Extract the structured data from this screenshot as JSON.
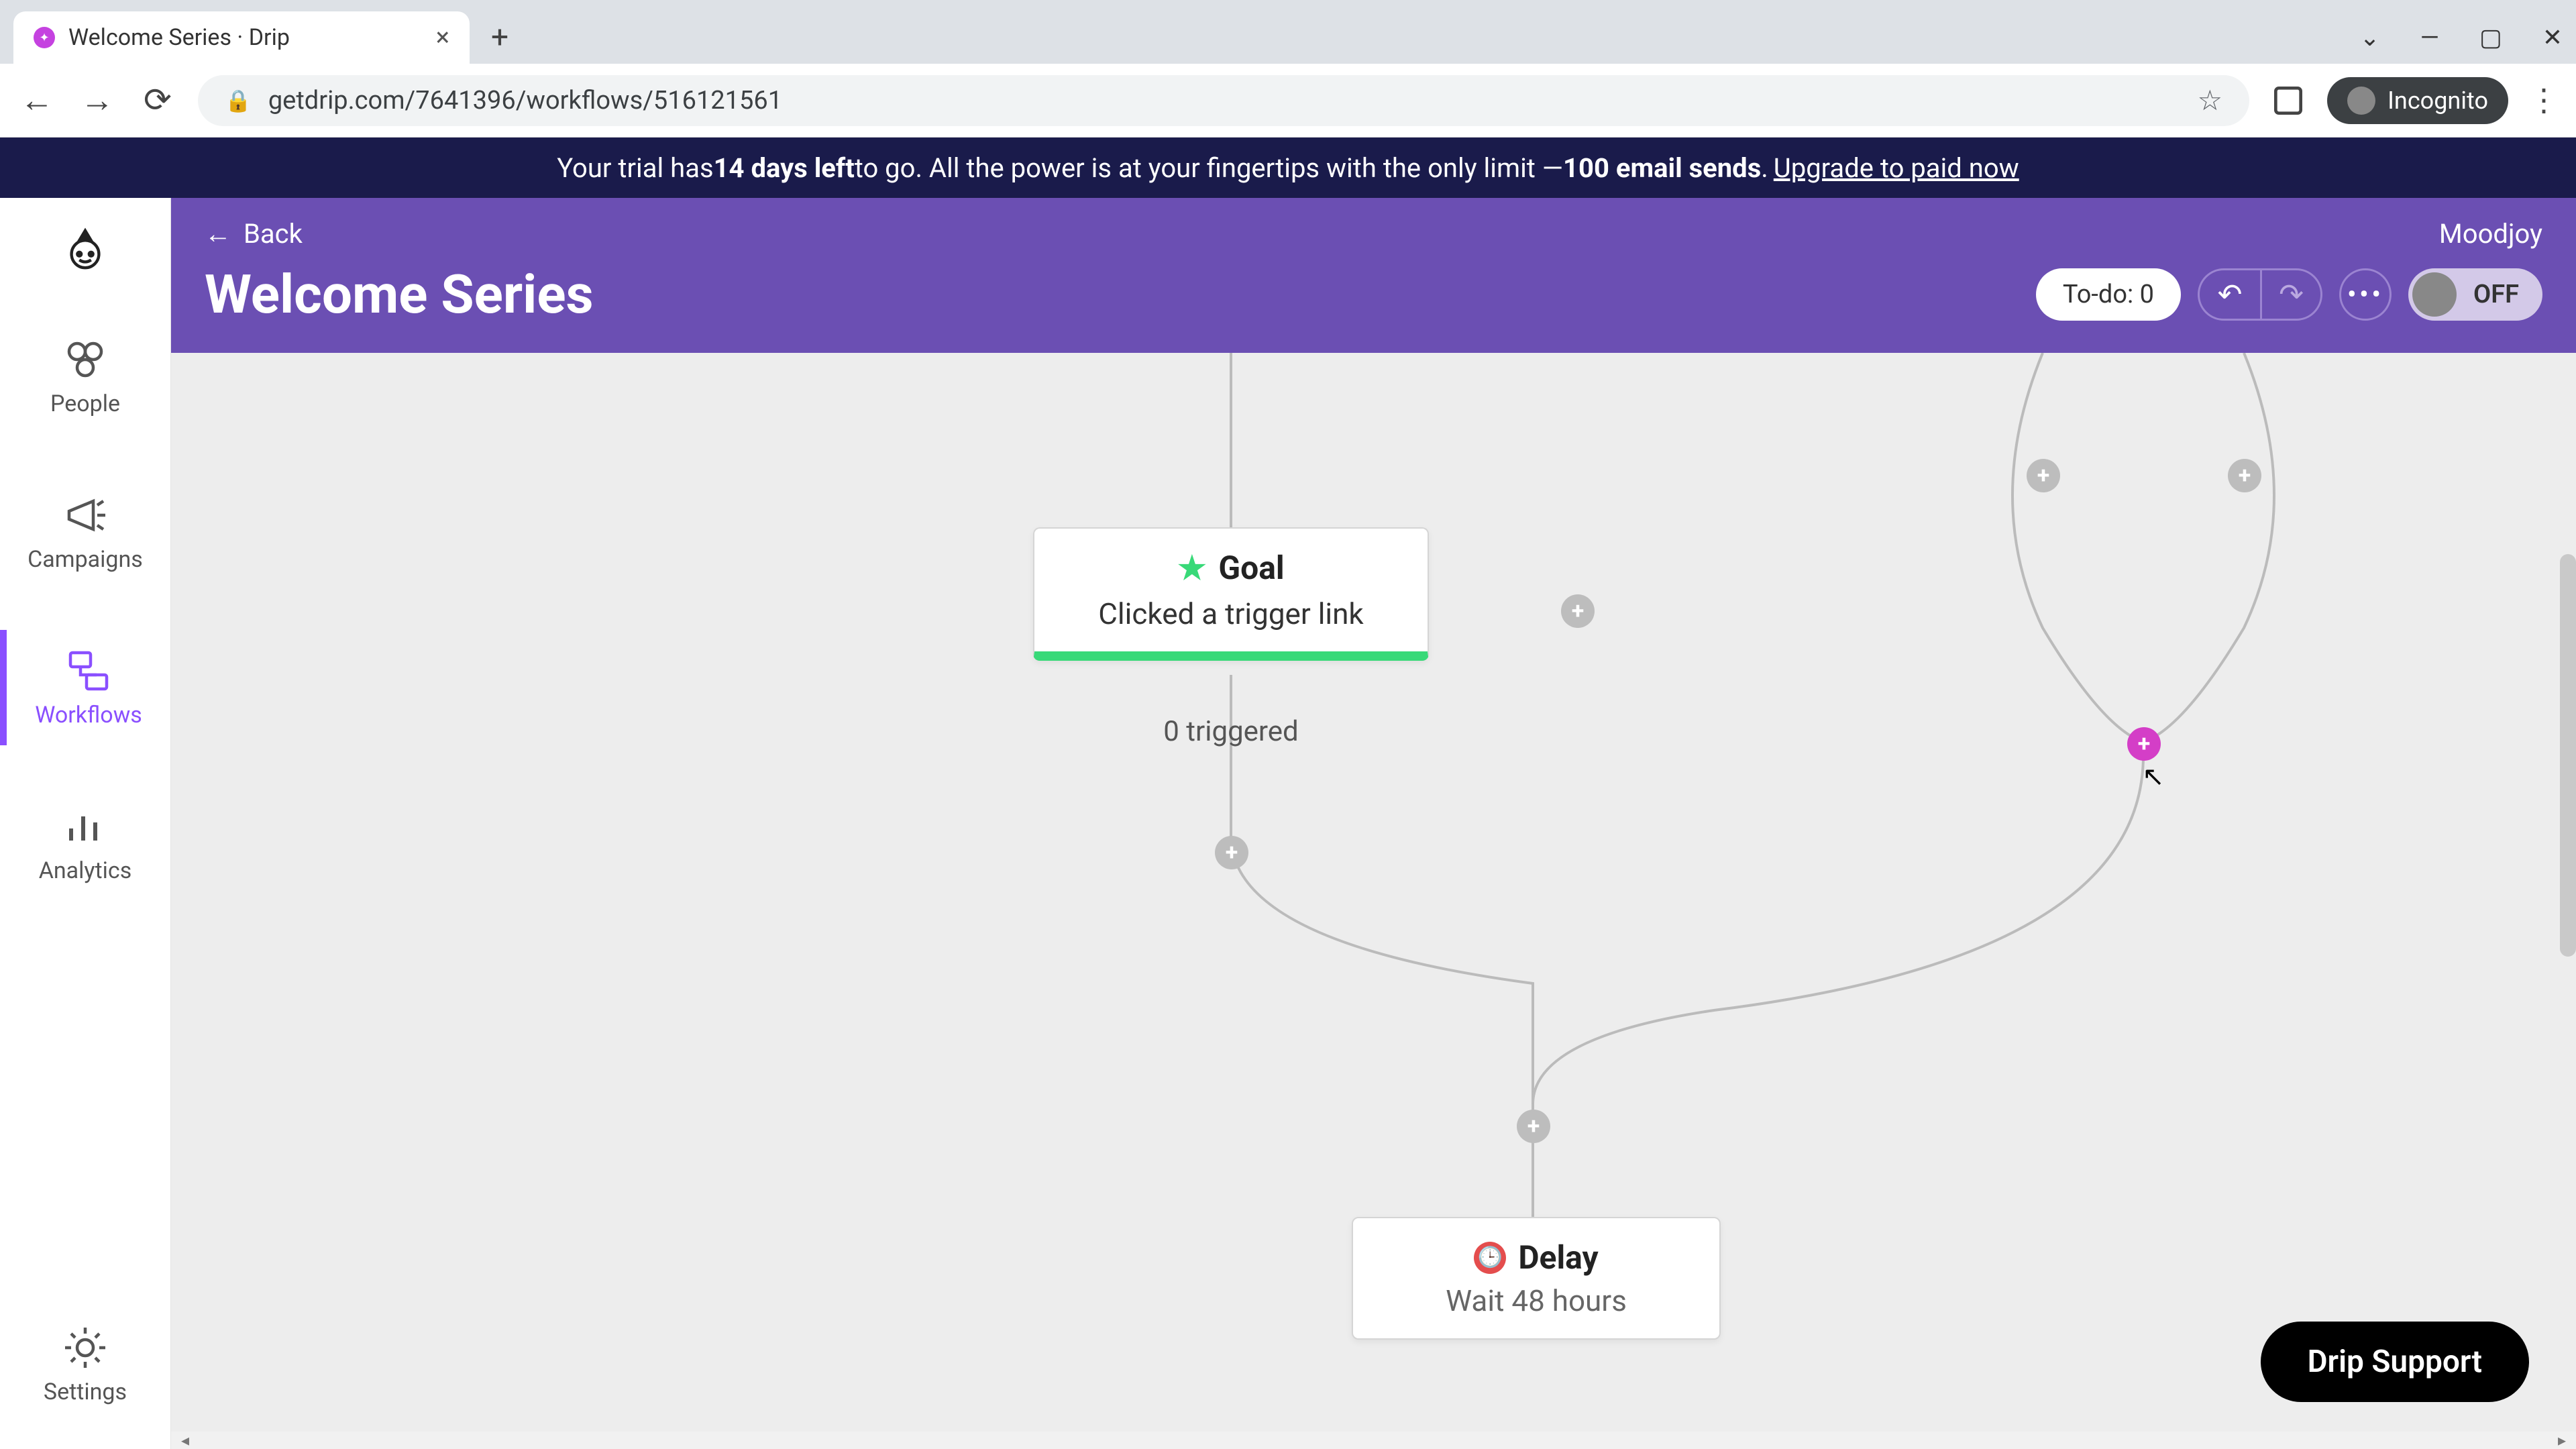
{
  "browser": {
    "tab_title": "Welcome Series · Drip",
    "url": "getdrip.com/7641396/workflows/516121561",
    "incognito_label": "Incognito"
  },
  "trial": {
    "prefix": "Your trial has ",
    "bold1": "14 days left",
    "mid": " to go. All the power is at your fingertips with the only limit — ",
    "bold2": "100 email sends",
    "suffix": ". ",
    "link": "Upgrade to paid now"
  },
  "sidebar": {
    "items": [
      {
        "label": "People"
      },
      {
        "label": "Campaigns"
      },
      {
        "label": "Workflows"
      },
      {
        "label": "Analytics"
      },
      {
        "label": "Settings"
      }
    ]
  },
  "header": {
    "back": "Back",
    "workspace": "Moodjoy",
    "title": "Welcome Series",
    "todo": "To-do: 0",
    "toggle": "OFF"
  },
  "canvas": {
    "goal": {
      "title": "Goal",
      "subtitle": "Clicked a trigger link",
      "count": "0 triggered"
    },
    "delay": {
      "title": "Delay",
      "subtitle": "Wait 48 hours"
    }
  },
  "support": "Drip Support",
  "colors": {
    "purple": "#6b4fb3",
    "accent_pink": "#d43ec7",
    "green": "#38d978",
    "red": "#e44d4d",
    "trial_bg": "#1a1b4b"
  }
}
